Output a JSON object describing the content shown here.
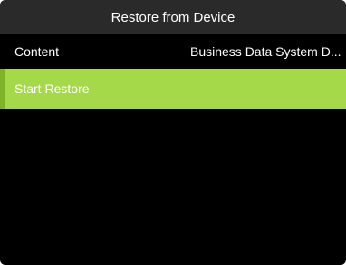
{
  "window": {
    "title": "Restore from Device"
  },
  "rows": [
    {
      "label": "Content",
      "value": "Business Data System D..."
    },
    {
      "label": "Start Restore"
    }
  ],
  "colors": {
    "background": "#000000",
    "title_bar": "#2a2a2a",
    "selected_row": "#a6d94a",
    "text": "#ffffff"
  }
}
